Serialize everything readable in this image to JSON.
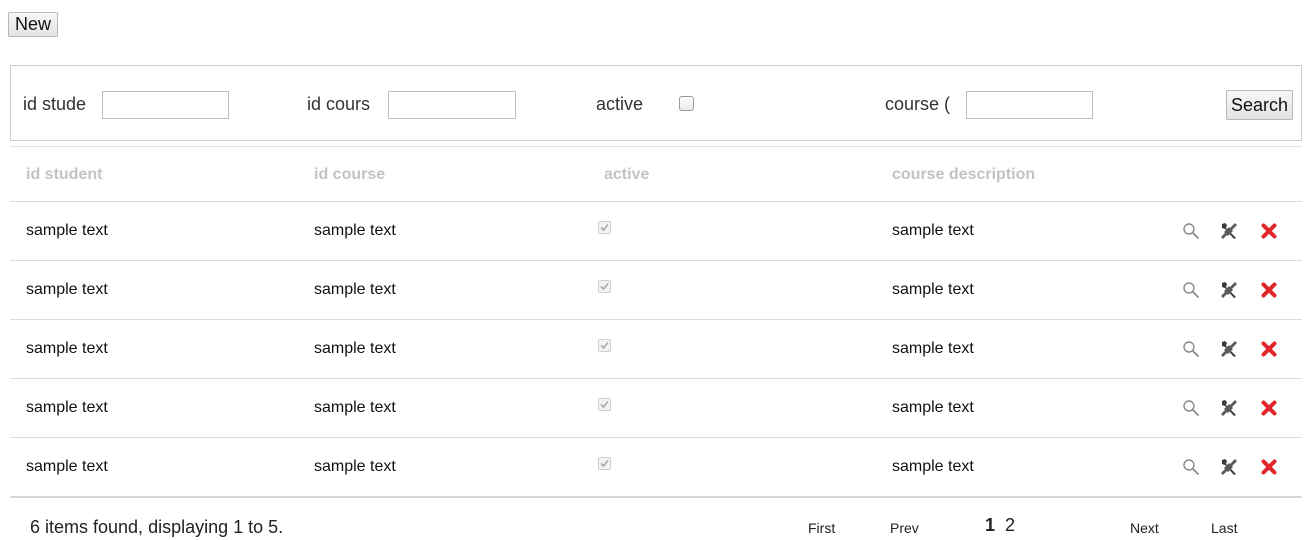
{
  "toolbar": {
    "new_label": "New"
  },
  "search": {
    "fields": [
      {
        "label": "id stude",
        "value": "",
        "placeholder": ""
      },
      {
        "label": "id cours",
        "value": "",
        "placeholder": ""
      },
      {
        "label": "course (",
        "value": "",
        "placeholder": ""
      }
    ],
    "active_label": "active",
    "active_checked": false,
    "search_label": "Search"
  },
  "table": {
    "columns": [
      "id student",
      "id course",
      "active",
      "course description"
    ],
    "rows": [
      {
        "id_student": "sample text",
        "id_course": "sample text",
        "active": true,
        "course_description": "sample text"
      },
      {
        "id_student": "sample text",
        "id_course": "sample text",
        "active": true,
        "course_description": "sample text"
      },
      {
        "id_student": "sample text",
        "id_course": "sample text",
        "active": true,
        "course_description": "sample text"
      },
      {
        "id_student": "sample text",
        "id_course": "sample text",
        "active": true,
        "course_description": "sample text"
      },
      {
        "id_student": "sample text",
        "id_course": "sample text",
        "active": true,
        "course_description": "sample text"
      }
    ],
    "row_actions": [
      "magnifier-icon",
      "tools-icon",
      "delete-icon"
    ]
  },
  "footer": {
    "status": "6 items found, displaying 1 to 5.",
    "first": "First",
    "prev": "Prev",
    "pages": [
      "1",
      "2"
    ],
    "current_page": "1",
    "next": "Next",
    "last": "Last"
  },
  "colors": {
    "header_text": "#c3c3c3",
    "delete_icon": "#e0262a",
    "border": "#dcdcdc"
  }
}
